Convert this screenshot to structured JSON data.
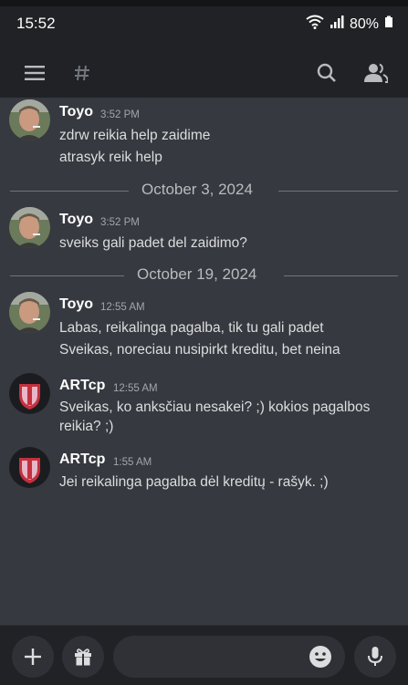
{
  "status_bar": {
    "time": "15:52",
    "battery": "80%"
  },
  "top_bar": {
    "hamburger_icon": "menu-icon",
    "channel_icon": "hash-icon",
    "search_icon": "search-icon",
    "members_icon": "members-icon"
  },
  "messages": [
    {
      "author": "Toyo",
      "time": "3:52 PM",
      "lines": [
        "zdrw reikia help zaidime",
        "atrasyk reik help"
      ]
    },
    {
      "divider": "October 3, 2024"
    },
    {
      "author": "Toyo",
      "time": "3:52 PM",
      "lines": [
        "sveiks gali padet del zaidimo?"
      ]
    },
    {
      "divider": "October 19, 2024"
    },
    {
      "author": "Toyo",
      "time": "12:55 AM",
      "lines": [
        "Labas, reikalinga pagalba, tik tu gali padet",
        "Sveikas, noreciau nusipirkt kreditu, bet neina"
      ]
    },
    {
      "author": "ARTcp",
      "time": "12:55 AM",
      "lines": [
        "Sveikas, ko anksčiau nesakei? ;) kokios pagalbos",
        "reikia? ;)"
      ]
    },
    {
      "author": "ARTcp",
      "time": "1:55 AM",
      "lines": [
        "Jei reikalinga pagalba dėl kreditų - rašyk. ;)"
      ]
    }
  ],
  "bottom_bar": {
    "input_placeholder": "",
    "add_icon": "plus-icon",
    "gift_icon": "gift-icon",
    "emoji_icon": "emoji-icon",
    "mic_icon": "microphone-icon"
  },
  "colors": {
    "background": "#36393f",
    "bars": "#202225",
    "brand_red": "#c4303e"
  }
}
